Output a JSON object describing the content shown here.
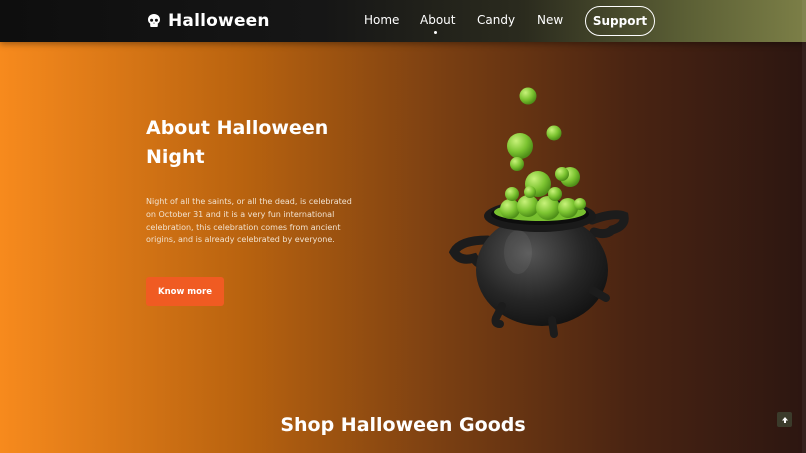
{
  "brand": {
    "name": "Halloween",
    "logo_icon": "skull-icon"
  },
  "nav": {
    "items": [
      {
        "label": "Home",
        "active": false
      },
      {
        "label": "About",
        "active": true
      },
      {
        "label": "Candy",
        "active": false
      },
      {
        "label": "New",
        "active": false
      }
    ],
    "support_label": "Support"
  },
  "hero": {
    "title_line1": "About Halloween",
    "title_line2": "Night",
    "description": "Night of all the saints, or all the dead, is celebrated on October 31 and it is a very fun international celebration, this celebration comes from ancient origins, and is already celebrated by everyone.",
    "cta_label": "Know more",
    "image": "cauldron-illustration"
  },
  "shop": {
    "title": "Shop Halloween Goods"
  },
  "scroll_top": {
    "icon": "arrow-up-icon"
  },
  "colors": {
    "accent": "#f05b22",
    "bg_start": "#f78a1d",
    "bg_end": "#2c1611",
    "potion": "#8fd13f"
  }
}
